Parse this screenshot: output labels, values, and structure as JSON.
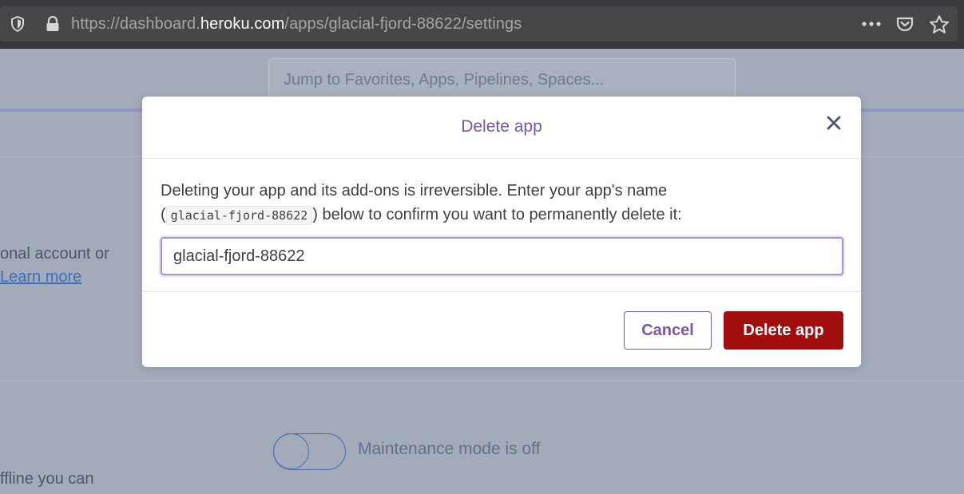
{
  "browser": {
    "url_prefix": "https://dashboard.",
    "url_domain": "heroku.com",
    "url_suffix": "/apps/glacial-fjord-88622/settings"
  },
  "background": {
    "search_placeholder": "Jump to Favorites, Apps, Pipelines, Spaces...",
    "text_account": "onal account or",
    "learn_more_link": "Learn more",
    "toggle_state": "off",
    "maintenance_label": "Maintenance mode is off",
    "text_offline": "ffline you can"
  },
  "modal": {
    "title": "Delete app",
    "description_line1": "Deleting your app and its add-ons is irreversible. Enter your app's name",
    "open_paren": "(",
    "app_name_code": "glacial-fjord-88622",
    "description_line2": ") below to confirm you want to permanently delete it:",
    "input_value": "glacial-fjord-88622",
    "cancel_label": "Cancel",
    "delete_label": "Delete app"
  },
  "colors": {
    "accent_purple": "#79589f",
    "danger_red": "#a20d0d",
    "overlay": "#a3abba"
  }
}
